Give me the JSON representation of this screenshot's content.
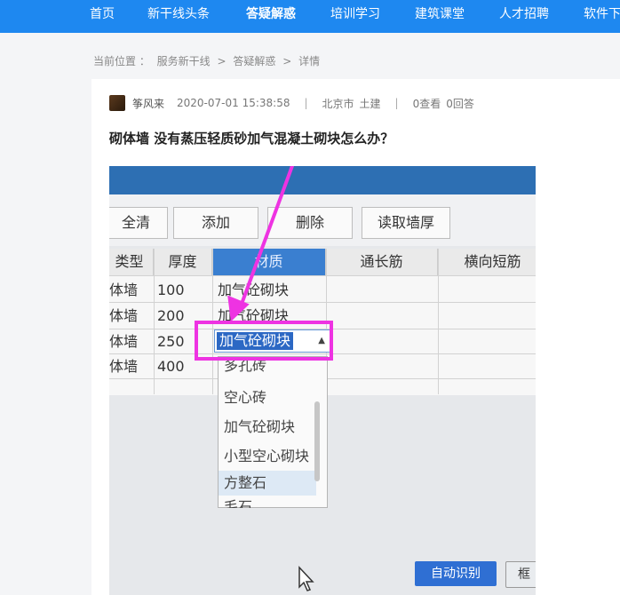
{
  "nav": {
    "items": [
      {
        "label": "首页",
        "active": false
      },
      {
        "label": "新干线头条",
        "active": false
      },
      {
        "label": "答疑解惑",
        "active": true
      },
      {
        "label": "培训学习",
        "active": false
      },
      {
        "label": "建筑课堂",
        "active": false
      },
      {
        "label": "人才招聘",
        "active": false
      },
      {
        "label": "软件下",
        "active": false
      }
    ]
  },
  "breadcrumb": {
    "prefix": "当前位置 ：",
    "items": [
      "服务新干线",
      ">",
      "答疑解惑",
      ">",
      "详情"
    ]
  },
  "question": {
    "author": "筝风来",
    "datetime": "2020-07-01 15:38:58",
    "separator": "|",
    "location": "北京市",
    "category": "土建",
    "views": "0查看",
    "answers": "0回答",
    "title": "砌体墙 没有蒸压轻质砂加气混凝土砌块怎么办？"
  },
  "screenshot_photo": {
    "toolbar_buttons": [
      "全清",
      "添加",
      "删除",
      "读取墙厚"
    ],
    "table_headers": [
      "类型",
      "厚度",
      "材质",
      "通长筋",
      "横向短筋"
    ],
    "rows": [
      {
        "type": "体墙",
        "thickness": "100",
        "material": "加气砼砌块"
      },
      {
        "type": "体墙",
        "thickness": "200",
        "material": "加气砼砌块"
      },
      {
        "type": "体墙",
        "thickness": "250",
        "material": ""
      },
      {
        "type": "体墙",
        "thickness": "400",
        "material": ""
      }
    ],
    "combo_value": "加气砼砌块",
    "dropdown_options": [
      "多孔砖",
      "空心砖",
      "加气砼砌块",
      "小型空心砌块",
      "方整石",
      "毛石"
    ],
    "highlighted_option": "方整石",
    "bottom_buttons": [
      "自动识别",
      "框"
    ],
    "annotation_color": "#ee33e2"
  },
  "colors": {
    "nav_bg": "#1e88f0",
    "accent": "#2f6fd3"
  }
}
